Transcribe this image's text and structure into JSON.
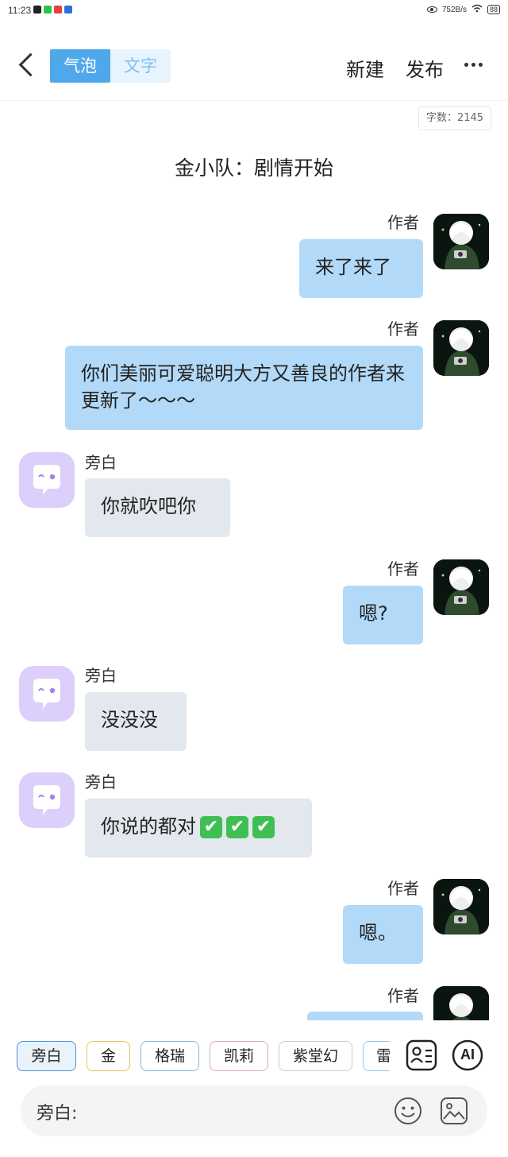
{
  "status_bar": {
    "time": "11:23",
    "net_speed": "752B/s",
    "battery": "88",
    "app_colors": [
      "#222222",
      "#2ec24b",
      "#e8403a",
      "#2f6fdc"
    ]
  },
  "header": {
    "tabs": [
      {
        "label": "气泡",
        "active": true
      },
      {
        "label": "文字",
        "active": false
      }
    ],
    "new_label": "新建",
    "publish_label": "发布"
  },
  "word_count": "字数：2145",
  "chapter_title": "金小队：剧情开始",
  "messages": [
    {
      "side": "right",
      "name": "作者",
      "text": "来了来了"
    },
    {
      "side": "right",
      "name": "作者",
      "text": "你们美丽可爱聪明大方又善良的作者来更新了～～～"
    },
    {
      "side": "left",
      "name": "旁白",
      "text": "你就吹吧你"
    },
    {
      "side": "right",
      "name": "作者",
      "text": "嗯?"
    },
    {
      "side": "left",
      "name": "旁白",
      "text": "没没没"
    },
    {
      "side": "left",
      "name": "旁白",
      "text": "你说的都对",
      "emoji": "✔",
      "emoji_count": 3
    },
    {
      "side": "right",
      "name": "作者",
      "text": "嗯。"
    },
    {
      "side": "right",
      "name": "作者",
      "text": ""
    }
  ],
  "role_chips": [
    {
      "label": "旁白",
      "color": "#4a90d9",
      "selected": true
    },
    {
      "label": "金",
      "color": "#e8c15a",
      "selected": false
    },
    {
      "label": "格瑞",
      "color": "#7fb6df",
      "selected": false
    },
    {
      "label": "凯莉",
      "color": "#e2a7b8",
      "selected": false
    },
    {
      "label": "紫堂幻",
      "color": "#cccccc",
      "selected": false
    },
    {
      "label": "雷",
      "color": "#8ec8ef",
      "selected": false
    }
  ],
  "ai_label": "AI",
  "input": {
    "label": "旁白:"
  },
  "colors": {
    "accent": "#4fa8ea",
    "bubble_right": "#b2daf8",
    "bubble_left": "#e3e7ee",
    "narrator_avatar": "#dccffb"
  }
}
